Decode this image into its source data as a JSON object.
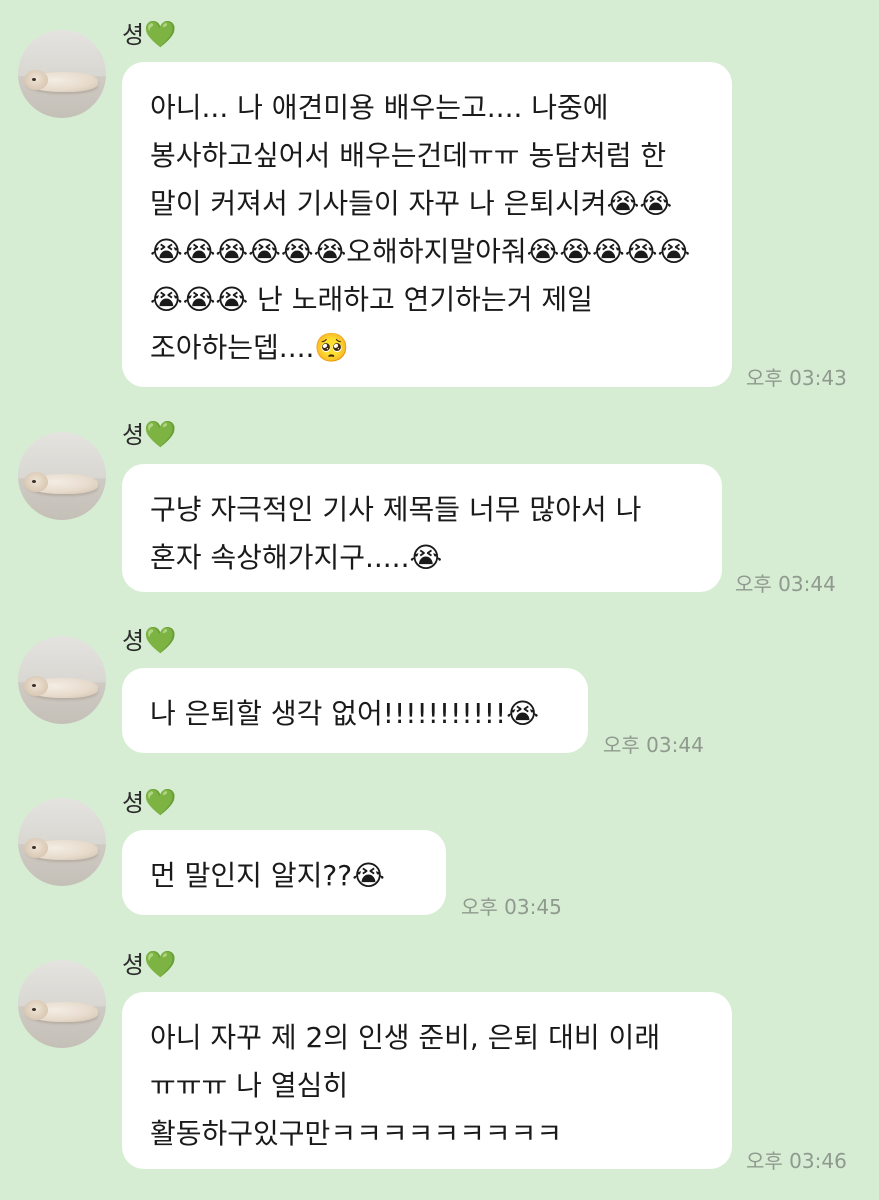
{
  "chat": {
    "messages": [
      {
        "sender": "셩",
        "heart": "💚",
        "text": "아니... 나 애견미용 배우는고.... 나중에 봉사하고싶어서 배우는건데ㅠㅠ 농담처럼 한 말이 커져서 기사들이 자꾸 나 은퇴시켜😭😭😭😭😭😭😭😭오해하지말아줘😭😭😭😭😭😭😭😭 난 노래하고 연기하는거 제일 조아하는뎁....🥺",
        "time": "오후 03:43"
      },
      {
        "sender": "셩",
        "heart": "💚",
        "text": "구냥 자극적인 기사 제목들 너무 많아서 나 혼자 속상해가지구.....😭",
        "time": "오후 03:44"
      },
      {
        "sender": "셩",
        "heart": "💚",
        "text": "나 은퇴할 생각 없어!!!!!!!!!!!😭",
        "time": "오후 03:44"
      },
      {
        "sender": "셩",
        "heart": "💚",
        "text": "먼 말인지 알지??😭",
        "time": "오후 03:45"
      },
      {
        "sender": "셩",
        "heart": "💚",
        "text": "아니 자꾸 제 2의 인생 준비, 은퇴 대비 이래 ㅠㅠㅠ 나 열심히 활동하구있구만ㅋㅋㅋㅋㅋㅋㅋㅋㅋ",
        "time": "오후 03:46"
      }
    ]
  }
}
